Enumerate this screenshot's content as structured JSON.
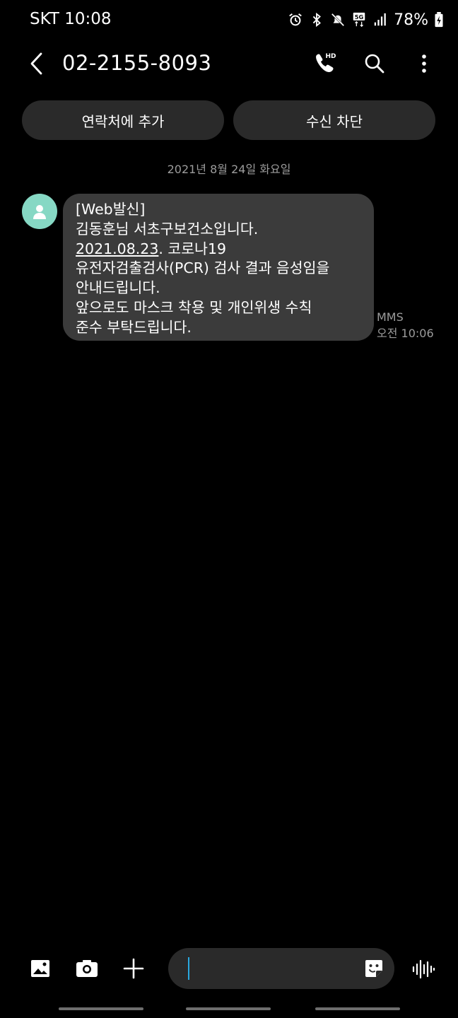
{
  "status_bar": {
    "carrier_time": "SKT 10:08",
    "icons": [
      "alarm-icon",
      "bluetooth-icon",
      "mute-icon",
      "5g-icon",
      "signal-icon"
    ],
    "battery": "78%"
  },
  "header": {
    "title": "02-2155-8093",
    "icons": [
      "back-arrow-icon",
      "hd-call-icon",
      "search-icon",
      "more-options-icon"
    ]
  },
  "actions": {
    "add_contact": "연락처에 추가",
    "block": "수신 차단"
  },
  "date_separator": "2021년 8월 24일 화요일",
  "message": {
    "lines": [
      "[Web발신]",
      "김동훈님 서초구보건소입니다.",
      "2021.08.23",
      ". 코로나19",
      "유전자검출검사(PCR) 검사 결과 음성임을",
      "안내드립니다.",
      "앞으로도 마스크 착용 및 개인위생 수칙",
      "준수 부탁드립니다."
    ],
    "type": "MMS",
    "time": "오전 10:06"
  },
  "composer": {
    "icons": [
      "gallery-icon",
      "camera-icon",
      "plus-icon",
      "sticker-icon",
      "voice-icon"
    ],
    "text": ""
  },
  "colors": {
    "background": "#000000",
    "bubble": "#3b3b3b",
    "button": "#2a2a2a",
    "avatar": "#86d8c4",
    "cursor": "#29a8e0"
  }
}
